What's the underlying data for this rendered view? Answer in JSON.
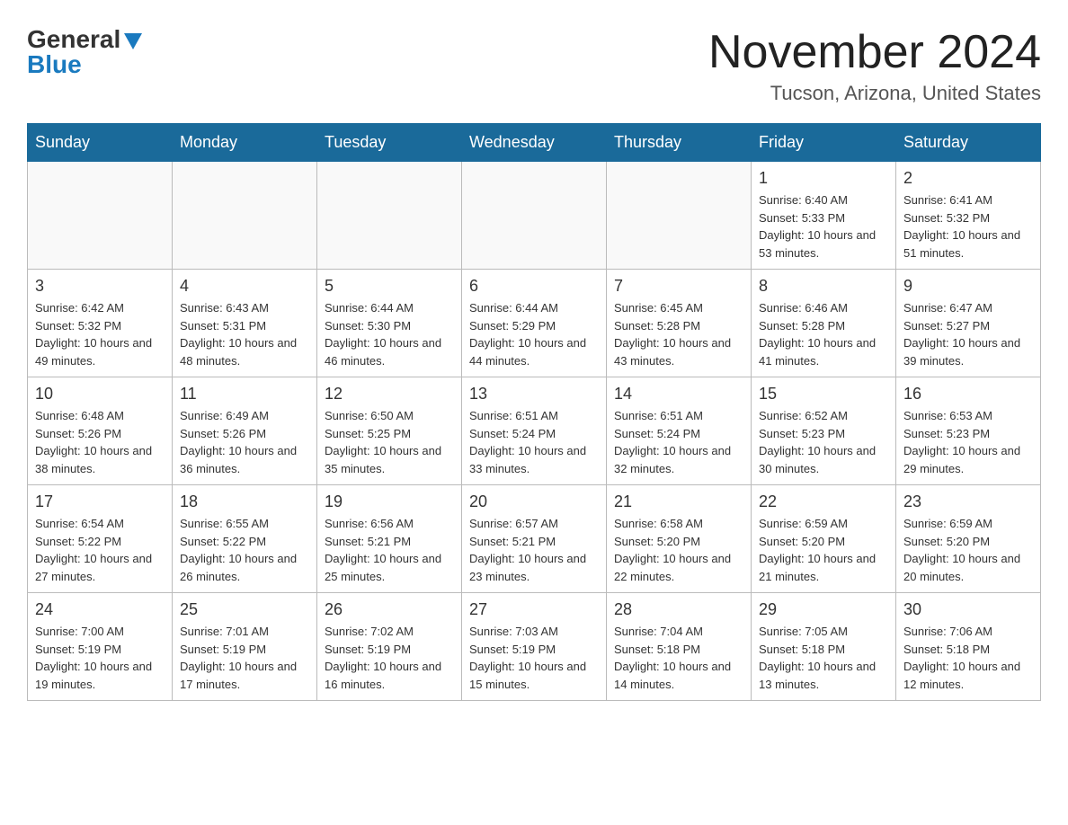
{
  "header": {
    "logo_general": "General",
    "logo_blue": "Blue",
    "month_title": "November 2024",
    "location": "Tucson, Arizona, United States"
  },
  "days_of_week": [
    "Sunday",
    "Monday",
    "Tuesday",
    "Wednesday",
    "Thursday",
    "Friday",
    "Saturday"
  ],
  "weeks": [
    [
      {
        "day": "",
        "info": ""
      },
      {
        "day": "",
        "info": ""
      },
      {
        "day": "",
        "info": ""
      },
      {
        "day": "",
        "info": ""
      },
      {
        "day": "",
        "info": ""
      },
      {
        "day": "1",
        "info": "Sunrise: 6:40 AM\nSunset: 5:33 PM\nDaylight: 10 hours and 53 minutes."
      },
      {
        "day": "2",
        "info": "Sunrise: 6:41 AM\nSunset: 5:32 PM\nDaylight: 10 hours and 51 minutes."
      }
    ],
    [
      {
        "day": "3",
        "info": "Sunrise: 6:42 AM\nSunset: 5:32 PM\nDaylight: 10 hours and 49 minutes."
      },
      {
        "day": "4",
        "info": "Sunrise: 6:43 AM\nSunset: 5:31 PM\nDaylight: 10 hours and 48 minutes."
      },
      {
        "day": "5",
        "info": "Sunrise: 6:44 AM\nSunset: 5:30 PM\nDaylight: 10 hours and 46 minutes."
      },
      {
        "day": "6",
        "info": "Sunrise: 6:44 AM\nSunset: 5:29 PM\nDaylight: 10 hours and 44 minutes."
      },
      {
        "day": "7",
        "info": "Sunrise: 6:45 AM\nSunset: 5:28 PM\nDaylight: 10 hours and 43 minutes."
      },
      {
        "day": "8",
        "info": "Sunrise: 6:46 AM\nSunset: 5:28 PM\nDaylight: 10 hours and 41 minutes."
      },
      {
        "day": "9",
        "info": "Sunrise: 6:47 AM\nSunset: 5:27 PM\nDaylight: 10 hours and 39 minutes."
      }
    ],
    [
      {
        "day": "10",
        "info": "Sunrise: 6:48 AM\nSunset: 5:26 PM\nDaylight: 10 hours and 38 minutes."
      },
      {
        "day": "11",
        "info": "Sunrise: 6:49 AM\nSunset: 5:26 PM\nDaylight: 10 hours and 36 minutes."
      },
      {
        "day": "12",
        "info": "Sunrise: 6:50 AM\nSunset: 5:25 PM\nDaylight: 10 hours and 35 minutes."
      },
      {
        "day": "13",
        "info": "Sunrise: 6:51 AM\nSunset: 5:24 PM\nDaylight: 10 hours and 33 minutes."
      },
      {
        "day": "14",
        "info": "Sunrise: 6:51 AM\nSunset: 5:24 PM\nDaylight: 10 hours and 32 minutes."
      },
      {
        "day": "15",
        "info": "Sunrise: 6:52 AM\nSunset: 5:23 PM\nDaylight: 10 hours and 30 minutes."
      },
      {
        "day": "16",
        "info": "Sunrise: 6:53 AM\nSunset: 5:23 PM\nDaylight: 10 hours and 29 minutes."
      }
    ],
    [
      {
        "day": "17",
        "info": "Sunrise: 6:54 AM\nSunset: 5:22 PM\nDaylight: 10 hours and 27 minutes."
      },
      {
        "day": "18",
        "info": "Sunrise: 6:55 AM\nSunset: 5:22 PM\nDaylight: 10 hours and 26 minutes."
      },
      {
        "day": "19",
        "info": "Sunrise: 6:56 AM\nSunset: 5:21 PM\nDaylight: 10 hours and 25 minutes."
      },
      {
        "day": "20",
        "info": "Sunrise: 6:57 AM\nSunset: 5:21 PM\nDaylight: 10 hours and 23 minutes."
      },
      {
        "day": "21",
        "info": "Sunrise: 6:58 AM\nSunset: 5:20 PM\nDaylight: 10 hours and 22 minutes."
      },
      {
        "day": "22",
        "info": "Sunrise: 6:59 AM\nSunset: 5:20 PM\nDaylight: 10 hours and 21 minutes."
      },
      {
        "day": "23",
        "info": "Sunrise: 6:59 AM\nSunset: 5:20 PM\nDaylight: 10 hours and 20 minutes."
      }
    ],
    [
      {
        "day": "24",
        "info": "Sunrise: 7:00 AM\nSunset: 5:19 PM\nDaylight: 10 hours and 19 minutes."
      },
      {
        "day": "25",
        "info": "Sunrise: 7:01 AM\nSunset: 5:19 PM\nDaylight: 10 hours and 17 minutes."
      },
      {
        "day": "26",
        "info": "Sunrise: 7:02 AM\nSunset: 5:19 PM\nDaylight: 10 hours and 16 minutes."
      },
      {
        "day": "27",
        "info": "Sunrise: 7:03 AM\nSunset: 5:19 PM\nDaylight: 10 hours and 15 minutes."
      },
      {
        "day": "28",
        "info": "Sunrise: 7:04 AM\nSunset: 5:18 PM\nDaylight: 10 hours and 14 minutes."
      },
      {
        "day": "29",
        "info": "Sunrise: 7:05 AM\nSunset: 5:18 PM\nDaylight: 10 hours and 13 minutes."
      },
      {
        "day": "30",
        "info": "Sunrise: 7:06 AM\nSunset: 5:18 PM\nDaylight: 10 hours and 12 minutes."
      }
    ]
  ]
}
